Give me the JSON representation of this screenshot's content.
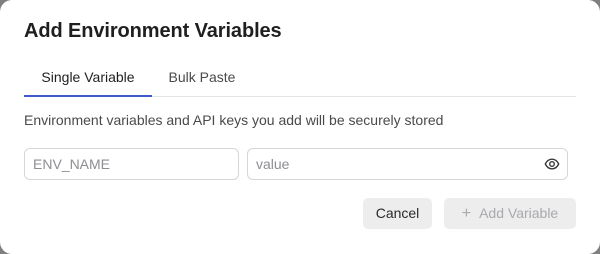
{
  "dialog": {
    "title": "Add Environment Variables",
    "tabs": [
      {
        "label": "Single Variable",
        "active": true
      },
      {
        "label": "Bulk Paste",
        "active": false
      }
    ],
    "description": "Environment variables and API keys you add will be securely stored",
    "name_input": {
      "placeholder": "ENV_NAME",
      "value": ""
    },
    "value_input": {
      "placeholder": "value",
      "value": ""
    },
    "value_icon": "eye-icon",
    "buttons": {
      "cancel_label": "Cancel",
      "add_label": "Add Variable",
      "add_icon": "plus-icon",
      "add_disabled": true
    },
    "colors": {
      "accent": "#3f5bc9",
      "button_bg": "#ededee",
      "disabled_text": "#a9a9ae"
    }
  }
}
